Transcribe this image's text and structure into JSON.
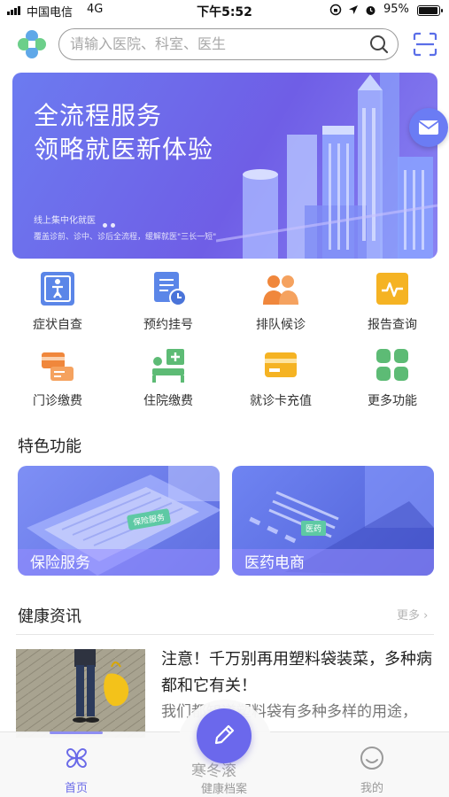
{
  "status_bar": {
    "carrier": "中国电信",
    "network": "4G",
    "time": "下午5:52",
    "battery": "95%",
    "battery_level": 0.95
  },
  "header": {
    "search_placeholder": "请输入医院、科室、医生"
  },
  "banner": {
    "title_line1": "全流程服务",
    "title_line2": "领略就医新体验",
    "subtitle": "线上集中化就医",
    "description": "覆盖诊前、诊中、诊后全流程，缓解就医\"三长一短\""
  },
  "features": [
    {
      "label": "症状自查",
      "icon": "body-check-icon"
    },
    {
      "label": "预约挂号",
      "icon": "appointment-icon"
    },
    {
      "label": "排队候诊",
      "icon": "queue-icon"
    },
    {
      "label": "报告查询",
      "icon": "report-icon"
    },
    {
      "label": "门诊缴费",
      "icon": "outpatient-payment-icon"
    },
    {
      "label": "住院缴费",
      "icon": "inpatient-payment-icon"
    },
    {
      "label": "就诊卡充值",
      "icon": "card-recharge-icon"
    },
    {
      "label": "更多功能",
      "icon": "more-features-icon"
    }
  ],
  "special": {
    "title": "特色功能",
    "cards": [
      {
        "label": "保险服务",
        "image_text": "保险服务"
      },
      {
        "label": "医药电商",
        "image_text": "医药"
      }
    ]
  },
  "news": {
    "title": "健康资讯",
    "more": "更多 ›",
    "items": [
      {
        "title": "注意！千万别再用塑料袋装菜，多种病都和它有关！",
        "summary": "我们都知道塑料袋有多种多样的用途，"
      }
    ]
  },
  "tab_bar": {
    "home": "首页",
    "records": "健康档案",
    "me": "我的",
    "partial_text": "寒冬滚"
  },
  "colors": {
    "brand": "#6b68ec",
    "banner": "#6f66ea",
    "icon_blue": "#5b86e8",
    "icon_orange": "#f0873c",
    "icon_yellow": "#f5b323",
    "icon_green": "#5dbb75"
  }
}
